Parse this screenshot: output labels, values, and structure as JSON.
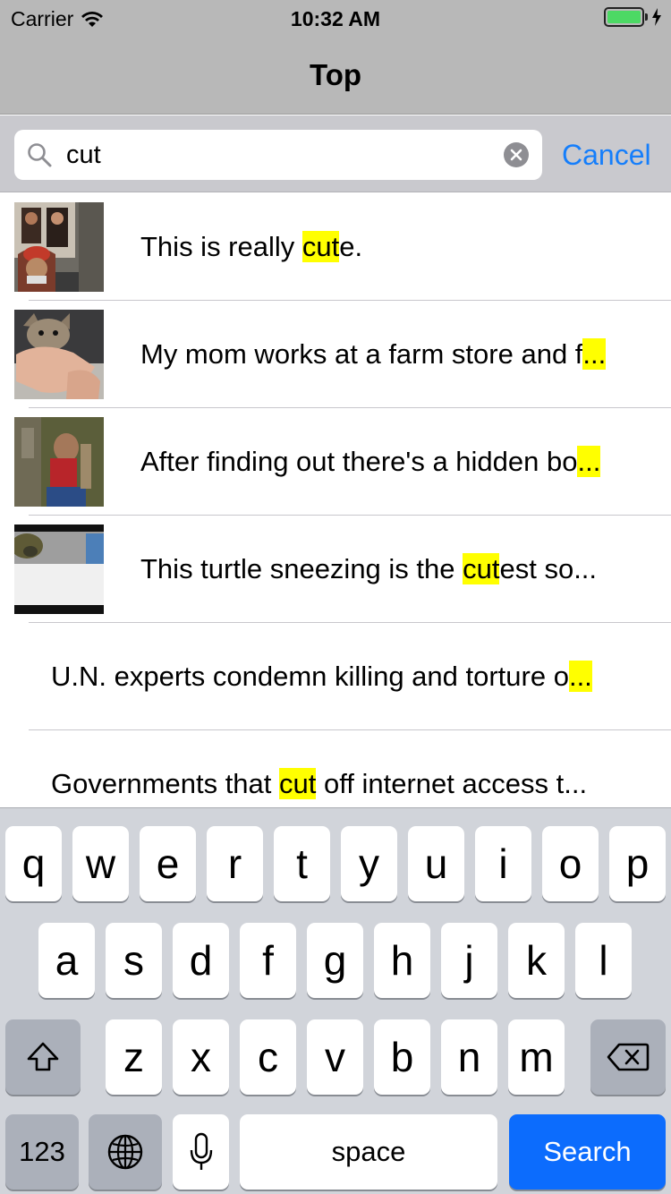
{
  "status_bar": {
    "carrier": "Carrier",
    "time": "10:32 AM",
    "battery_color": "#4cd964"
  },
  "nav": {
    "title": "Top"
  },
  "search": {
    "query": "cut",
    "cancel_label": "Cancel"
  },
  "results": [
    {
      "parts": [
        {
          "t": "This is really ",
          "h": false
        },
        {
          "t": "cut",
          "h": true
        },
        {
          "t": "e.",
          "h": false
        }
      ],
      "thumb": "two-people-photo"
    },
    {
      "parts": [
        {
          "t": "My mom works at a farm store and f",
          "h": false
        },
        {
          "t": "...",
          "h": true
        }
      ],
      "thumb": "kitten-in-hands"
    },
    {
      "parts": [
        {
          "t": "After finding out there's a hidden bo",
          "h": false
        },
        {
          "t": "...",
          "h": true
        }
      ],
      "thumb": "child-at-door"
    },
    {
      "parts": [
        {
          "t": "This turtle sneezing is the ",
          "h": false
        },
        {
          "t": "cut",
          "h": true
        },
        {
          "t": "est so...",
          "h": false
        }
      ],
      "thumb": "turtle-video"
    },
    {
      "parts": [
        {
          "t": "U.N. experts condemn killing and torture o",
          "h": false
        },
        {
          "t": "...",
          "h": true
        }
      ],
      "thumb": null
    },
    {
      "parts": [
        {
          "t": "Governments that ",
          "h": false
        },
        {
          "t": "cut",
          "h": true
        },
        {
          "t": " off internet access t...",
          "h": false
        }
      ],
      "thumb": null
    }
  ],
  "keyboard": {
    "row1": [
      "q",
      "w",
      "e",
      "r",
      "t",
      "y",
      "u",
      "i",
      "o",
      "p"
    ],
    "row2": [
      "a",
      "s",
      "d",
      "f",
      "g",
      "h",
      "j",
      "k",
      "l"
    ],
    "row3": [
      "z",
      "x",
      "c",
      "v",
      "b",
      "n",
      "m"
    ],
    "numbers_label": "123",
    "space_label": "space",
    "search_label": "Search",
    "search_key_color": "#0c6cfd"
  }
}
